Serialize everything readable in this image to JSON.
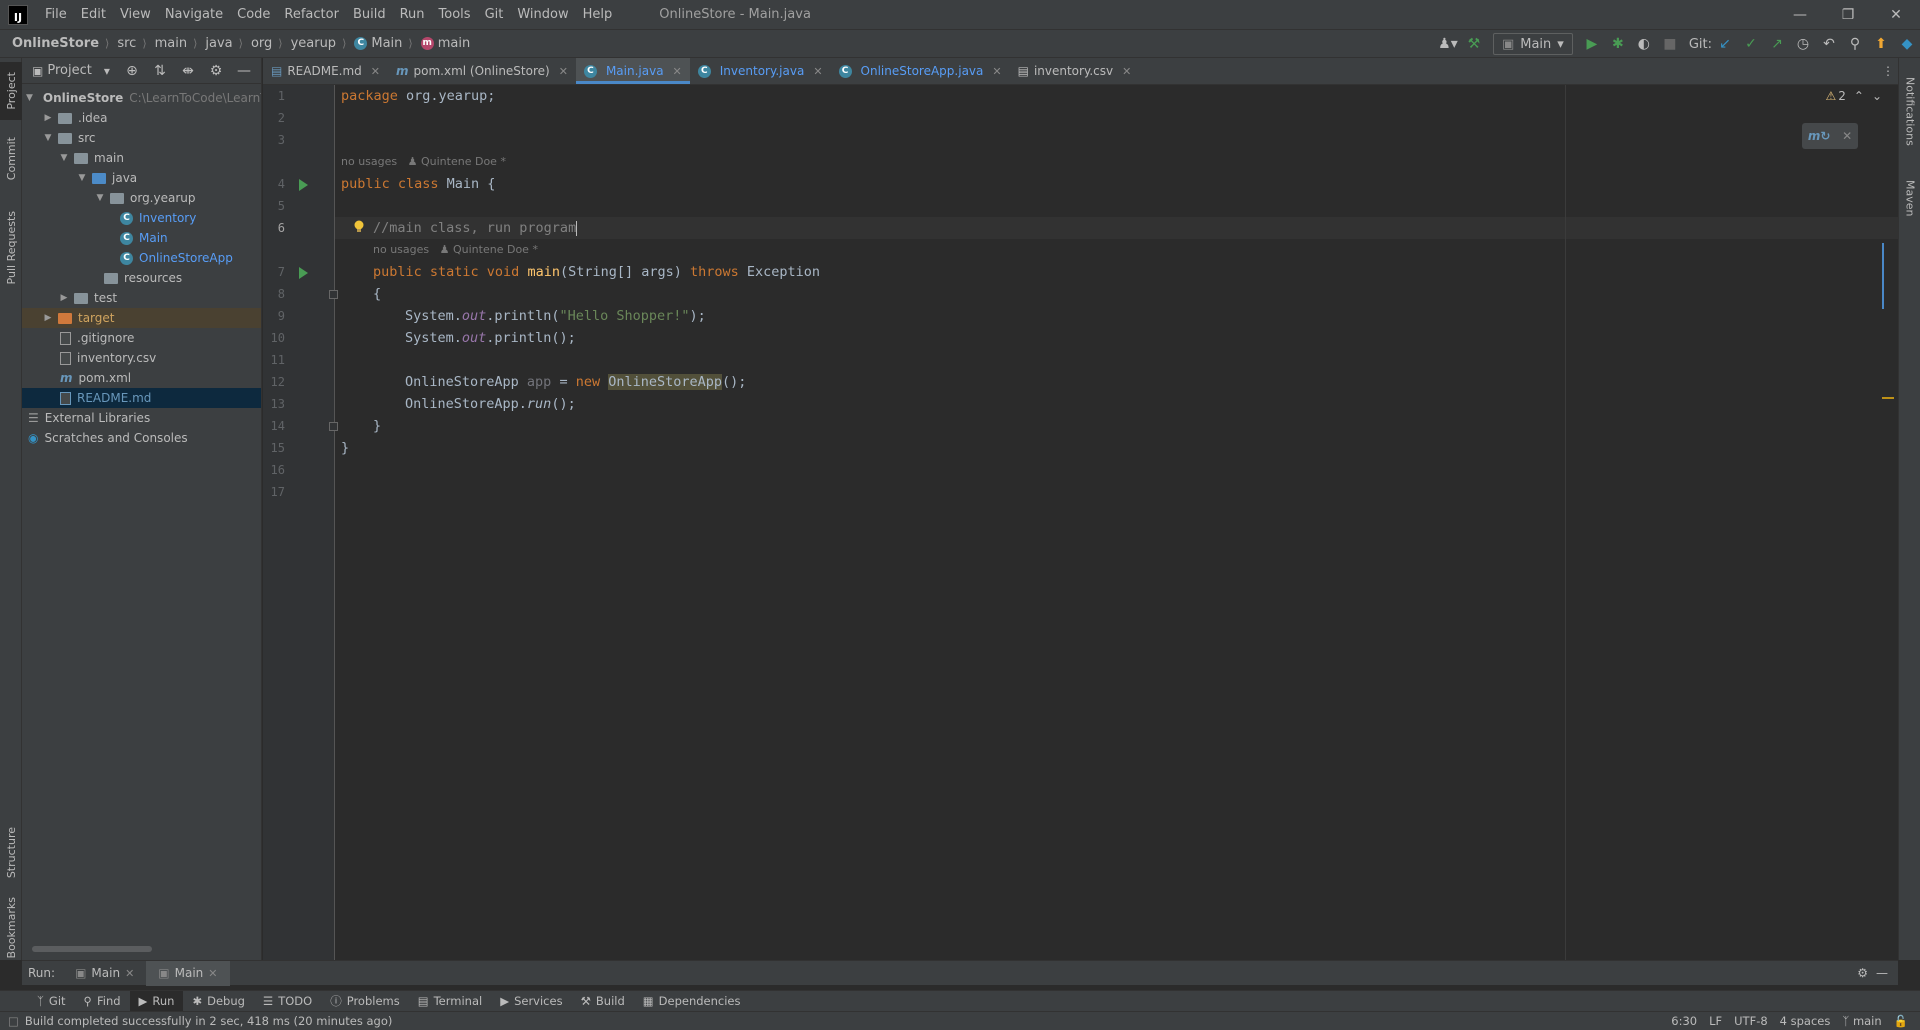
{
  "window": {
    "title": "OnlineStore - Main.java",
    "menu": [
      "File",
      "Edit",
      "View",
      "Navigate",
      "Code",
      "Refactor",
      "Build",
      "Run",
      "Tools",
      "Git",
      "Window",
      "Help"
    ],
    "logo": "IJ"
  },
  "breadcrumbs": [
    "OnlineStore",
    "src",
    "main",
    "java",
    "org",
    "yearup",
    "Main",
    "main"
  ],
  "toolbar": {
    "run_config": "Main",
    "git_label": "Git:"
  },
  "left_strip": [
    "Project",
    "Commit",
    "Pull Requests",
    "Structure",
    "Bookmarks"
  ],
  "right_strip": [
    "Notifications",
    "Maven"
  ],
  "project": {
    "header": "Project",
    "root": "OnlineStore",
    "root_path": "C:\\LearnToCode\\LearnToC",
    "items": [
      {
        "label": "OnlineStore",
        "depth": 0
      },
      {
        "label": ".idea",
        "depth": 1
      },
      {
        "label": "src",
        "depth": 1
      },
      {
        "label": "main",
        "depth": 2
      },
      {
        "label": "java",
        "depth": 3
      },
      {
        "label": "org.yearup",
        "depth": 4
      },
      {
        "label": "Inventory",
        "depth": 5
      },
      {
        "label": "Main",
        "depth": 5
      },
      {
        "label": "OnlineStoreApp",
        "depth": 5
      },
      {
        "label": "resources",
        "depth": 3
      },
      {
        "label": "test",
        "depth": 2
      },
      {
        "label": "target",
        "depth": 1
      },
      {
        "label": ".gitignore",
        "depth": 1
      },
      {
        "label": "inventory.csv",
        "depth": 1
      },
      {
        "label": "pom.xml",
        "depth": 1
      },
      {
        "label": "README.md",
        "depth": 1
      },
      {
        "label": "External Libraries",
        "depth": 0
      },
      {
        "label": "Scratches and Consoles",
        "depth": 0
      }
    ]
  },
  "tabs": [
    {
      "label": "README.md",
      "active": false
    },
    {
      "label": "pom.xml (OnlineStore)",
      "active": false
    },
    {
      "label": "Main.java",
      "active": true
    },
    {
      "label": "Inventory.java",
      "active": false
    },
    {
      "label": "OnlineStoreApp.java",
      "active": false
    },
    {
      "label": "inventory.csv",
      "active": false
    }
  ],
  "editor": {
    "warnings": "2",
    "inlay_usages": "no usages",
    "inlay_author": "Quintene Doe *",
    "line_numbers": [
      "1",
      "2",
      "3",
      "4",
      "5",
      "6",
      "7",
      "8",
      "9",
      "10",
      "11",
      "12",
      "13",
      "14",
      "15",
      "16",
      "17"
    ],
    "current_line": "6",
    "lines": [
      "package org.yearup;",
      "public class Main {",
      "//main class, run program",
      "public static void main(String[] args) throws Exception",
      "{",
      "System.out.println(\"Hello Shopper!\");",
      "System.out.println();",
      "OnlineStoreApp app = new OnlineStoreApp();",
      "OnlineStoreApp.run();",
      "}",
      "}"
    ]
  },
  "run_bar": {
    "label": "Run:",
    "tabs": [
      "Main",
      "Main"
    ]
  },
  "tool_windows": [
    "Git",
    "Find",
    "Run",
    "Debug",
    "TODO",
    "Problems",
    "Terminal",
    "Services",
    "Build",
    "Dependencies"
  ],
  "status": {
    "message": "Build completed successfully in 2 sec, 418 ms (20 minutes ago)",
    "position": "6:30",
    "line_sep": "LF",
    "encoding": "UTF-8",
    "indent": "4 spaces",
    "branch": "main"
  }
}
